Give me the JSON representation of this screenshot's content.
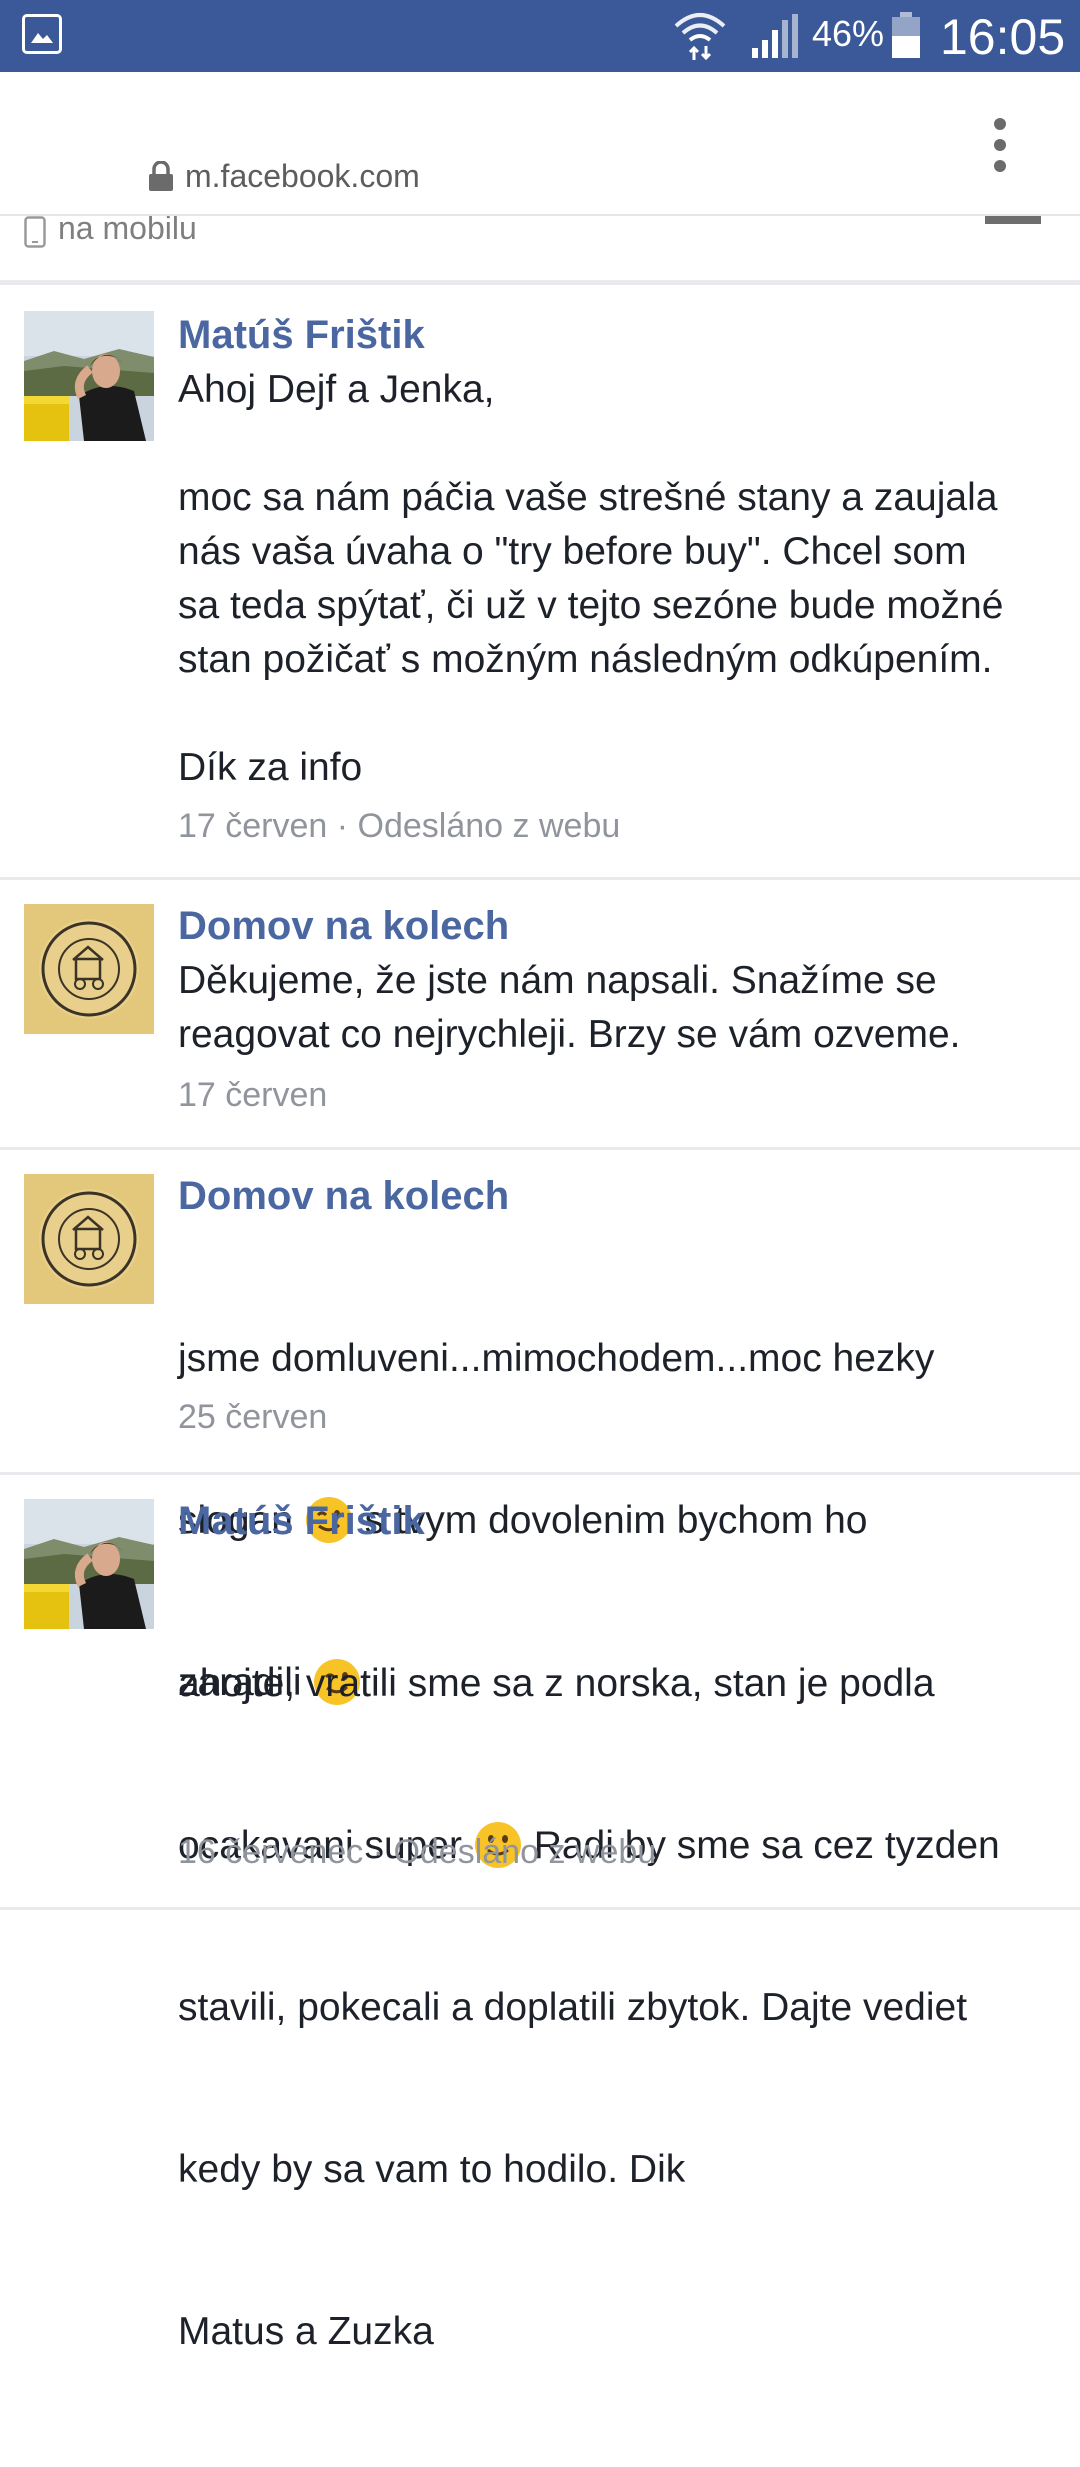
{
  "status_bar": {
    "battery_percent": "46%",
    "time": "16:05"
  },
  "browser": {
    "url": "m.facebook.com"
  },
  "partial_row": {
    "label": "na mobilu"
  },
  "messages": [
    {
      "author": "Matúš Frištik",
      "avatar": "profile-photo",
      "lines": [
        "Ahoj Dejf a Jenka,",
        "",
        "moc sa nám páčia vaše strešné stany a zaujala",
        "nás vaša úvaha o \"try before buy\". Chcel som",
        "sa teda spýtať, či už v tejto sezóne bude možné",
        "stan požičať s možným následným odkúpením.",
        "",
        "Dík za info"
      ],
      "date": "17 červen",
      "source": "Odesláno z webu"
    },
    {
      "author": "Domov na kolech",
      "avatar": "domov-na-kolech-logo",
      "lines": [
        "Děkujeme, že jste nám napsali. Snažíme se",
        "reagovat co nejrychleji. Brzy se vám ozveme."
      ],
      "date": "17 červen"
    },
    {
      "author": "Domov na kolech",
      "avatar": "domov-na-kolech-logo",
      "line1": "jsme domluveni...mimochodem...moc hezky",
      "line2a": "slogan",
      "line2b": "s tvym dovolenim bychom ho",
      "line3": "zaradili",
      "emoji": "wink-emoji",
      "date": "25 červen"
    },
    {
      "author": "Matúš Frištik",
      "avatar": "profile-photo",
      "line1": "ahojte, vratili sme sa z norska, stan je podla",
      "line2a": "ocakavani super",
      "line2b": "Radi by sme sa cez tyzden",
      "line3": "stavili, pokecali a doplatili zbytok. Dajte vediet",
      "line4": "kedy by sa vam to hodilo. Dik",
      "line5": "Matus a Zuzka",
      "emoji": "smile-emoji",
      "date": "16 červenec",
      "source": "Odesláno z webu"
    }
  ],
  "colors": {
    "status_bar": "#3b5998",
    "author": "#4b67a1",
    "meta": "#90949c",
    "separator": "#e9eaed"
  }
}
